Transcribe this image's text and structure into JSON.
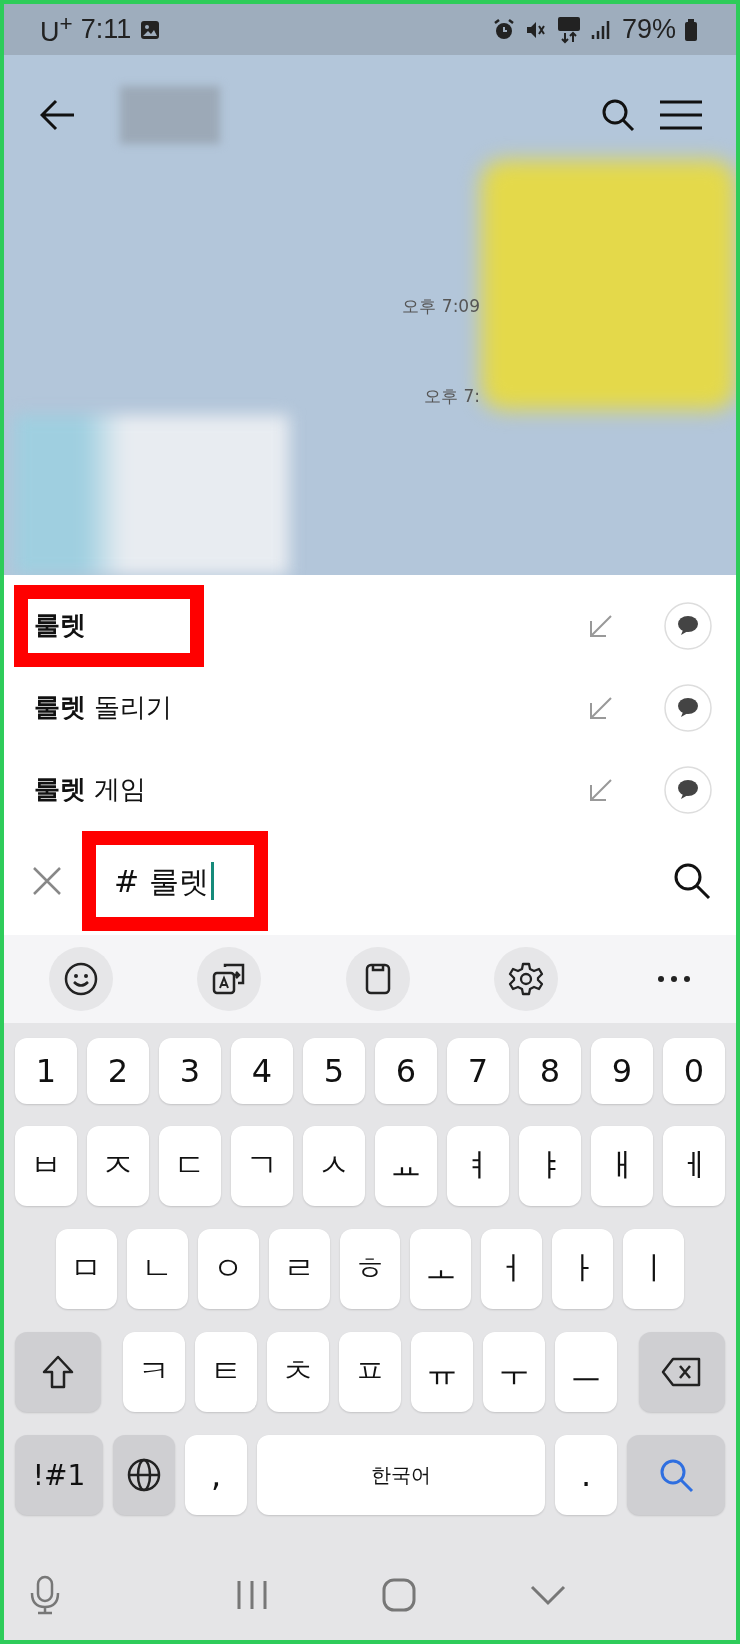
{
  "status_bar": {
    "carrier": "U$^{+}$",
    "time": "7:11",
    "battery": "79%"
  },
  "chat": {
    "timestamps": [
      "오후 7:09",
      "오후 7:"
    ]
  },
  "suggestions": [
    {
      "text": "**룰렛**",
      "highlighted": true
    },
    {
      "text": "**룰렛** 돌리기",
      "highlighted": false
    },
    {
      "text": "**룰렛** 게임",
      "highlighted": false
    }
  ],
  "search": {
    "value": "# 룰렛",
    "highlighted": true
  },
  "keyboard": {
    "rows": [
      [
        {
          "kind": "char",
          "label": "1"
        },
        {
          "kind": "char",
          "label": "2"
        },
        {
          "kind": "char",
          "label": "3"
        },
        {
          "kind": "char",
          "label": "4"
        },
        {
          "kind": "char",
          "label": "5"
        },
        {
          "kind": "char",
          "label": "6"
        },
        {
          "kind": "char",
          "label": "7"
        },
        {
          "kind": "char",
          "label": "8"
        },
        {
          "kind": "char",
          "label": "9"
        },
        {
          "kind": "char",
          "label": "0"
        }
      ],
      [
        {
          "kind": "char",
          "label": "ㅂ"
        },
        {
          "kind": "char",
          "label": "ㅈ"
        },
        {
          "kind": "char",
          "label": "ㄷ"
        },
        {
          "kind": "char",
          "label": "ㄱ"
        },
        {
          "kind": "char",
          "label": "ㅅ"
        },
        {
          "kind": "char",
          "label": "ㅛ"
        },
        {
          "kind": "char",
          "label": "ㅕ"
        },
        {
          "kind": "char",
          "label": "ㅑ"
        },
        {
          "kind": "char",
          "label": "ㅐ"
        },
        {
          "kind": "char",
          "label": "ㅔ"
        }
      ],
      [
        {
          "kind": "char",
          "label": "ㅁ"
        },
        {
          "kind": "char",
          "label": "ㄴ"
        },
        {
          "kind": "char",
          "label": "ㅇ"
        },
        {
          "kind": "char",
          "label": "ㄹ"
        },
        {
          "kind": "char",
          "label": "ㅎ"
        },
        {
          "kind": "char",
          "label": "ㅗ"
        },
        {
          "kind": "char",
          "label": "ㅓ"
        },
        {
          "kind": "char",
          "label": "ㅏ"
        },
        {
          "kind": "char",
          "label": "ㅣ"
        }
      ],
      [
        {
          "kind": "shift"
        },
        {
          "kind": "char",
          "label": "ㅋ"
        },
        {
          "kind": "char",
          "label": "ㅌ"
        },
        {
          "kind": "char",
          "label": "ㅊ"
        },
        {
          "kind": "char",
          "label": "ㅍ"
        },
        {
          "kind": "char",
          "label": "ㅠ"
        },
        {
          "kind": "char",
          "label": "ㅜ"
        },
        {
          "kind": "char",
          "label": "ㅡ"
        },
        {
          "kind": "backspace"
        }
      ],
      [
        {
          "kind": "symbols",
          "label": "!#1"
        },
        {
          "kind": "globe"
        },
        {
          "kind": "char",
          "label": ","
        },
        {
          "kind": "space",
          "label": "한국어"
        },
        {
          "kind": "char",
          "label": "."
        },
        {
          "kind": "enter"
        }
      ]
    ]
  }
}
